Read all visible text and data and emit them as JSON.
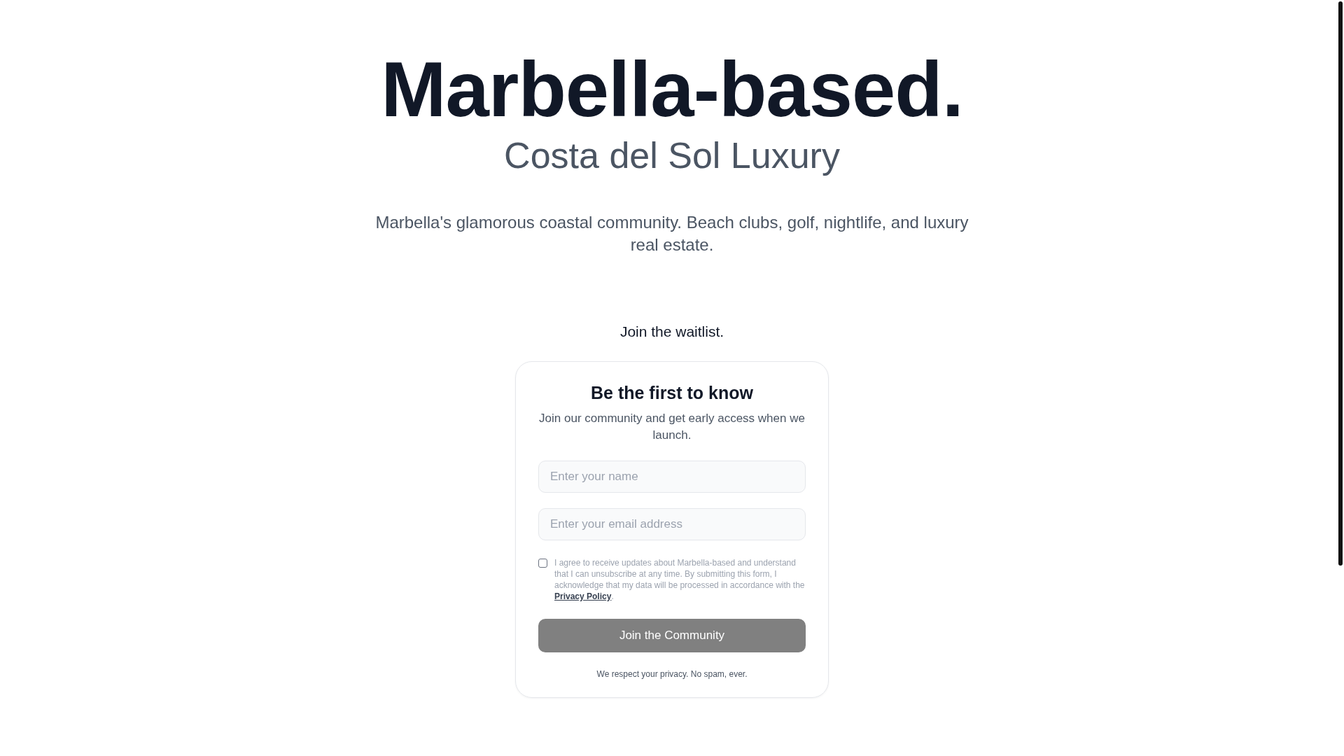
{
  "hero": {
    "title": "Marbella-based.",
    "subtitle": "Costa del Sol Luxury",
    "description": "Marbella's glamorous coastal community. Beach clubs, golf, nightlife, and luxury real estate."
  },
  "waitlist_heading": "Join the waitlist.",
  "card": {
    "title": "Be the first to know",
    "subtitle": "Join our community and get early access when we launch.",
    "fields": [
      {
        "placeholder": "Enter your name"
      },
      {
        "placeholder": "Enter your email address"
      }
    ],
    "consent": {
      "checked": false,
      "text": "I agree to receive updates about Marbella-based and understand that I can unsubscribe at any time. By submitting this form, I acknowledge that my data will be processed in accordance with the",
      "link": "Privacy Policy",
      "after": "."
    },
    "button": {
      "label": "Join the Community",
      "disabled": true
    },
    "footnote": "We respect your privacy. No spam, ever."
  }
}
